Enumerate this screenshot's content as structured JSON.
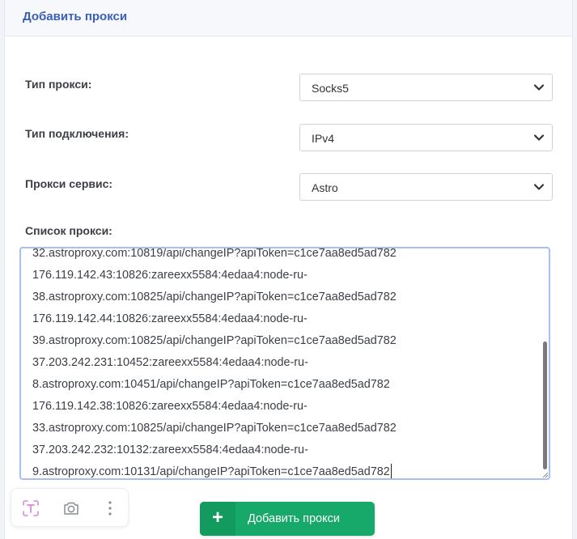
{
  "header": {
    "title": "Добавить прокси"
  },
  "form": {
    "proxy_type": {
      "label": "Тип прокси:",
      "value": "Socks5"
    },
    "connection_type": {
      "label": "Тип подключения:",
      "value": "IPv4"
    },
    "proxy_service": {
      "label": "Прокси сервис:",
      "value": "Astro"
    },
    "proxy_list": {
      "label": "Список прокси:",
      "lines": [
        "32.astroproxy.com:10819/api/changeIP?apiToken=c1ce7aa8ed5ad782",
        "176.119.142.43:10826:zareexx5584:4edaa4:node-ru-",
        "38.astroproxy.com:10825/api/changeIP?apiToken=c1ce7aa8ed5ad782",
        "176.119.142.44:10826:zareexx5584:4edaa4:node-ru-",
        "39.astroproxy.com:10825/api/changeIP?apiToken=c1ce7aa8ed5ad782",
        "37.203.242.231:10452:zareexx5584:4edaa4:node-ru-",
        "8.astroproxy.com:10451/api/changeIP?apiToken=c1ce7aa8ed5ad782",
        "176.119.142.38:10826:zareexx5584:4edaa4:node-ru-",
        "33.astroproxy.com:10825/api/changeIP?apiToken=c1ce7aa8ed5ad782",
        "37.203.242.232:10132:zareexx5584:4edaa4:node-ru-",
        "9.astroproxy.com:10131/api/changeIP?apiToken=c1ce7aa8ed5ad782"
      ]
    }
  },
  "actions": {
    "add_label": "Добавить прокси",
    "add_icon": "+"
  },
  "colors": {
    "accent": "#3a5fb8",
    "button": "#17a96a",
    "focus_border": "#a9c0ec"
  }
}
